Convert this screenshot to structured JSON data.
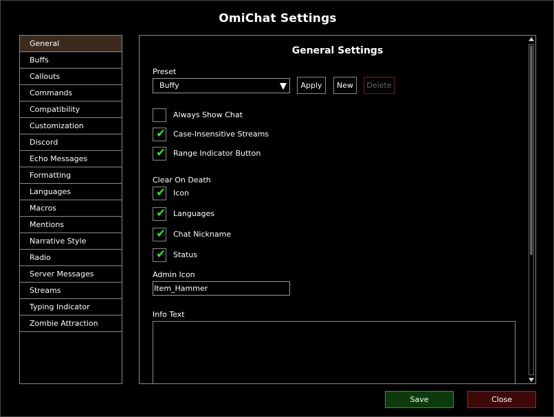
{
  "window": {
    "title": "OmiChat Settings"
  },
  "sidebar": {
    "items": [
      {
        "label": "General",
        "active": true
      },
      {
        "label": "Buffs"
      },
      {
        "label": "Callouts"
      },
      {
        "label": "Commands"
      },
      {
        "label": "Compatibility"
      },
      {
        "label": "Customization"
      },
      {
        "label": "Discord"
      },
      {
        "label": "Echo Messages"
      },
      {
        "label": "Formatting"
      },
      {
        "label": "Languages"
      },
      {
        "label": "Macros"
      },
      {
        "label": "Mentions"
      },
      {
        "label": "Narrative Style"
      },
      {
        "label": "Radio"
      },
      {
        "label": "Server Messages"
      },
      {
        "label": "Streams"
      },
      {
        "label": "Typing Indicator"
      },
      {
        "label": "Zombie Attraction"
      }
    ]
  },
  "main": {
    "heading": "General Settings",
    "preset": {
      "label": "Preset",
      "selected": "Buffy",
      "apply_label": "Apply",
      "new_label": "New",
      "delete_label": "Delete"
    },
    "options": [
      {
        "label": "Always Show Chat",
        "checked": false
      },
      {
        "label": "Case-Insensitive Streams",
        "checked": true
      },
      {
        "label": "Range Indicator Button",
        "checked": true
      }
    ],
    "clear_on_death": {
      "label": "Clear On Death",
      "items": [
        {
          "label": "Icon",
          "checked": true
        },
        {
          "label": "Languages",
          "checked": true
        },
        {
          "label": "Chat Nickname",
          "checked": true
        },
        {
          "label": "Status",
          "checked": true
        }
      ]
    },
    "admin_icon": {
      "label": "Admin Icon",
      "value": "Item_Hammer"
    },
    "info_text": {
      "label": "Info Text",
      "value": ""
    },
    "check_glyph": "✔"
  },
  "footer": {
    "save_label": "Save",
    "close_label": "Close"
  },
  "colors": {
    "active_item": "#3c2a1e",
    "check": "#2fe02f",
    "save_bg": "#0c3a0c",
    "save_border": "#2fa02f",
    "close_bg": "#3e0808",
    "close_border": "#a82424"
  }
}
